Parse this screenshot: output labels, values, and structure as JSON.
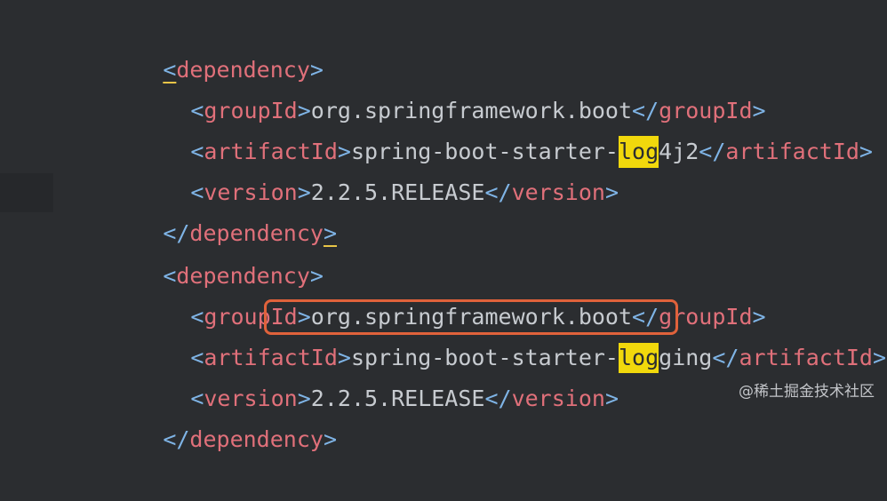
{
  "lines": [
    {
      "indent": "",
      "open_bracket": "<",
      "tag": "dependency",
      "close_bracket": ">"
    },
    {
      "indent": "  ",
      "open_bracket": "<",
      "tag": "groupId",
      "close_bracket": ">",
      "value": "org.springframework.boot",
      "end_open": "</",
      "end_tag": "groupId",
      "end_close": ">"
    },
    {
      "indent": "  ",
      "open_bracket": "<",
      "tag": "artifactId",
      "close_bracket": ">",
      "value_before": "spring-boot-starter-",
      "value_highlight": "log",
      "value_after": "4j2",
      "end_open": "</",
      "end_tag": "artifactId",
      "end_close": ">"
    },
    {
      "indent": "  ",
      "open_bracket": "<",
      "tag": "version",
      "close_bracket": ">",
      "value": "2.2.5.RELEASE",
      "end_open": "</",
      "end_tag": "version",
      "end_close": ">"
    },
    {
      "indent": "",
      "open_bracket": "</",
      "tag": "dependency",
      "close_bracket": ">"
    },
    {
      "indent": "",
      "open_bracket": "<",
      "tag": "dependency",
      "close_bracket": ">"
    },
    {
      "indent": "  ",
      "open_bracket": "<",
      "tag": "groupId",
      "close_bracket": ">",
      "value": "org.springframework.boot",
      "end_open": "</",
      "end_tag": "groupId",
      "end_close": ">"
    },
    {
      "indent": "  ",
      "open_bracket": "<",
      "tag": "artifactId",
      "close_bracket": ">",
      "value_before": "spring-boot-starter-",
      "value_highlight": "log",
      "value_after": "ging",
      "end_open": "</",
      "end_tag": "artifactId",
      "end_close": ">"
    },
    {
      "indent": "  ",
      "open_bracket": "<",
      "tag": "version",
      "close_bracket": ">",
      "value": "2.2.5.RELEASE",
      "end_open": "</",
      "end_tag": "version",
      "end_close": ">"
    },
    {
      "indent": "",
      "open_bracket": "</",
      "tag": "dependency",
      "close_bracket": ">"
    }
  ],
  "gutter": {
    "icon": "lightbulb-icon"
  },
  "search_highlight_color": "#f1d80c",
  "annotation_box_color": "#e0623b",
  "watermark": "@稀土掘金技术社区"
}
